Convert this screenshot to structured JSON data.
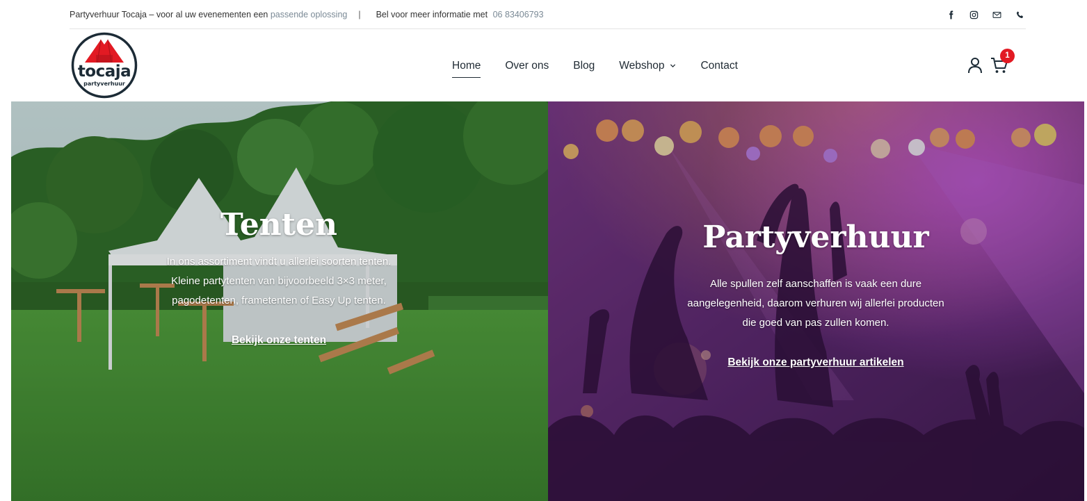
{
  "topbar": {
    "tagline_prefix": "Partyverhuur Tocaja – voor al uw evenementen een",
    "tagline_accent": "passende oplossing",
    "separator": "|",
    "contact_prefix": "Bel voor meer informatie met",
    "phone": "06 83406793",
    "social_icons": [
      "facebook-icon",
      "instagram-icon",
      "mail-icon",
      "phone-icon"
    ]
  },
  "logo": {
    "name": "tocaja",
    "tagline": "partyverhuur"
  },
  "nav": {
    "items": [
      {
        "label": "Home",
        "active": true
      },
      {
        "label": "Over ons"
      },
      {
        "label": "Blog"
      },
      {
        "label": "Webshop",
        "has_dropdown": true
      },
      {
        "label": "Contact"
      }
    ]
  },
  "cart": {
    "count": "1"
  },
  "panels": {
    "tents": {
      "title": "Tenten",
      "text": "In ons assortiment vindt u allerlei soorten tenten. Kleine partytenten van bijvoorbeeld 3×3 meter, pagodetenten, frametenten of Easy Up tenten.",
      "link": "Bekijk onze tenten "
    },
    "party": {
      "title": "Partyverhuur",
      "text": "Alle spullen zelf aanschaffen is vaak een dure aangelegenheid, daarom verhuren wij allerlei producten die goed van pas zullen komen.",
      "link": "Bekijk onze partyverhuur artikelen"
    }
  },
  "colors": {
    "accent_text": "#7b8a96",
    "badge": "#e21a23",
    "logo_red": "#e21a23",
    "logo_dark": "#1c2b36"
  }
}
